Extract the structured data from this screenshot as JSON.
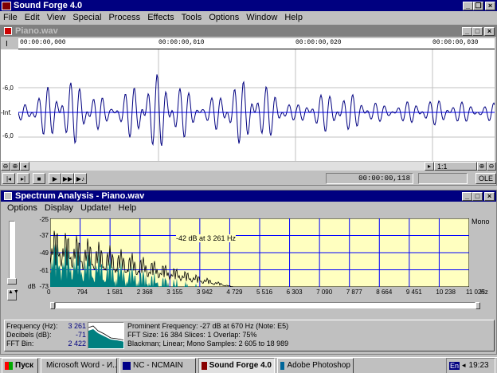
{
  "app": {
    "title": "Sound Forge 4.0"
  },
  "menu": [
    "File",
    "Edit",
    "View",
    "Special",
    "Process",
    "Effects",
    "Tools",
    "Options",
    "Window",
    "Help"
  ],
  "wave_window": {
    "title": "Piano.wav",
    "timeline": [
      "00:00:00,000",
      "00:00:00,010",
      "00:00:00,020",
      "00:00:00,030"
    ],
    "db_labels": [
      "-6,0",
      "-Inf.",
      "-6,0"
    ],
    "zoom_ratio": "1:1",
    "position": "00:00:00,118",
    "ole_label": "OLE"
  },
  "spectrum_window": {
    "title": "Spectrum Analysis - Piano.wav",
    "menu": [
      "Options",
      "Display",
      "Update!",
      "Help"
    ],
    "mono_label": "Mono",
    "cursor_label": "-42 dB at 3 261 Hz",
    "db_unit": "dB",
    "hz_unit": "Hz",
    "frequency_label": "Frequency (Hz):",
    "frequency_value": "3 261",
    "decibels_label": "Decibels (dB):",
    "decibels_value": "-71",
    "fft_bin_label": "FFT Bin:",
    "fft_bin_value": "2 422",
    "prominent": "Prominent Frequency: -27 dB at 670 Hz (Note: E5)",
    "fft_info": "FFT Size: 16 384  Slices: 1  Overlap: 75%",
    "window_info": "Blackman; Linear; Mono  Samples: 2 605 to 18 989"
  },
  "chart_data": {
    "type": "area",
    "y_ticks": [
      "-25",
      "-37",
      "-49",
      "-61",
      "-73"
    ],
    "x_ticks": [
      "0",
      "794",
      "1 581",
      "2 368",
      "3 155",
      "3 942",
      "4 729",
      "5 516",
      "6 303",
      "7 090",
      "7 877",
      "8 664",
      "9 451",
      "10 238",
      "11 025"
    ],
    "ylim": [
      -73,
      -25
    ],
    "xlim": [
      0,
      11025
    ],
    "grid": true,
    "fill_color": "#008080",
    "plot_background": "#ffffc0"
  },
  "taskbar": {
    "start": "Пуск",
    "items": [
      "Microsoft Word - И...",
      "NC - NCMAIN",
      "Sound Forge 4.0",
      "Adobe Photoshop"
    ],
    "lang": "En",
    "clock": "19:23"
  }
}
